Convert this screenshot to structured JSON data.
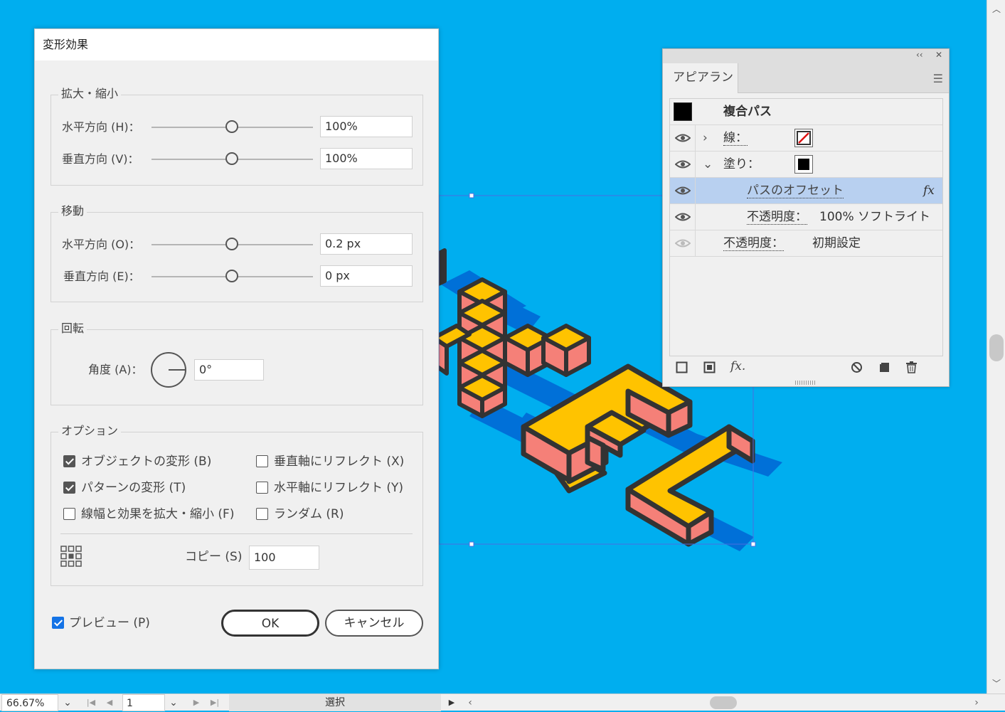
{
  "dialog": {
    "title": "変形効果",
    "scale": {
      "label": "拡大・縮小",
      "horizontal_label": "水平方向 (H)：",
      "horizontal_value": "100%",
      "vertical_label": "垂直方向 (V)：",
      "vertical_value": "100%"
    },
    "move": {
      "label": "移動",
      "horizontal_label": "水平方向 (O)：",
      "horizontal_value": "0.2 px",
      "vertical_label": "垂直方向 (E)：",
      "vertical_value": "0 px"
    },
    "rotate": {
      "label": "回転",
      "angle_label": "角度 (A)：",
      "angle_value": "0°"
    },
    "options": {
      "label": "オプション",
      "transform_objects": "オブジェクトの変形 (B)",
      "transform_objects_checked": true,
      "reflect_x": "垂直軸にリフレクト (X)",
      "reflect_x_checked": false,
      "transform_patterns": "パターンの変形 (T)",
      "transform_patterns_checked": true,
      "reflect_y": "水平軸にリフレクト (Y)",
      "reflect_y_checked": false,
      "scale_strokes": "線幅と効果を拡大・縮小 (F)",
      "scale_strokes_checked": false,
      "random": "ランダム (R)",
      "random_checked": false,
      "copies_label": "コピー (S)",
      "copies_value": "100"
    },
    "preview_label": "プレビュー (P)",
    "preview_checked": true,
    "ok_label": "OK",
    "cancel_label": "キャンセル"
  },
  "appearance": {
    "tab_label": "アピアランス",
    "title_row": "複合パス",
    "stroke_label": "線：",
    "fill_label": "塗り：",
    "effect_label": "パスのオフセット",
    "fx_label": "fx",
    "fill_opacity_label": "不透明度：",
    "fill_opacity_value": "100% ソフトライト",
    "opacity_label": "不透明度：",
    "opacity_value": "初期設定",
    "collapse_label": "‹‹",
    "close_label": "✕",
    "footer_fx_label": "fx."
  },
  "statusbar": {
    "zoom": "66.67%",
    "page": "1",
    "tool": "選択"
  },
  "colors": {
    "canvas_bg": "#00aeef",
    "cube_top": "#ffc300",
    "cube_side": "#f58078",
    "cube_shadow": "#0070d8",
    "outline": "#333333",
    "selection": "#4a6ee0",
    "accent_blue": "#1473e6"
  }
}
